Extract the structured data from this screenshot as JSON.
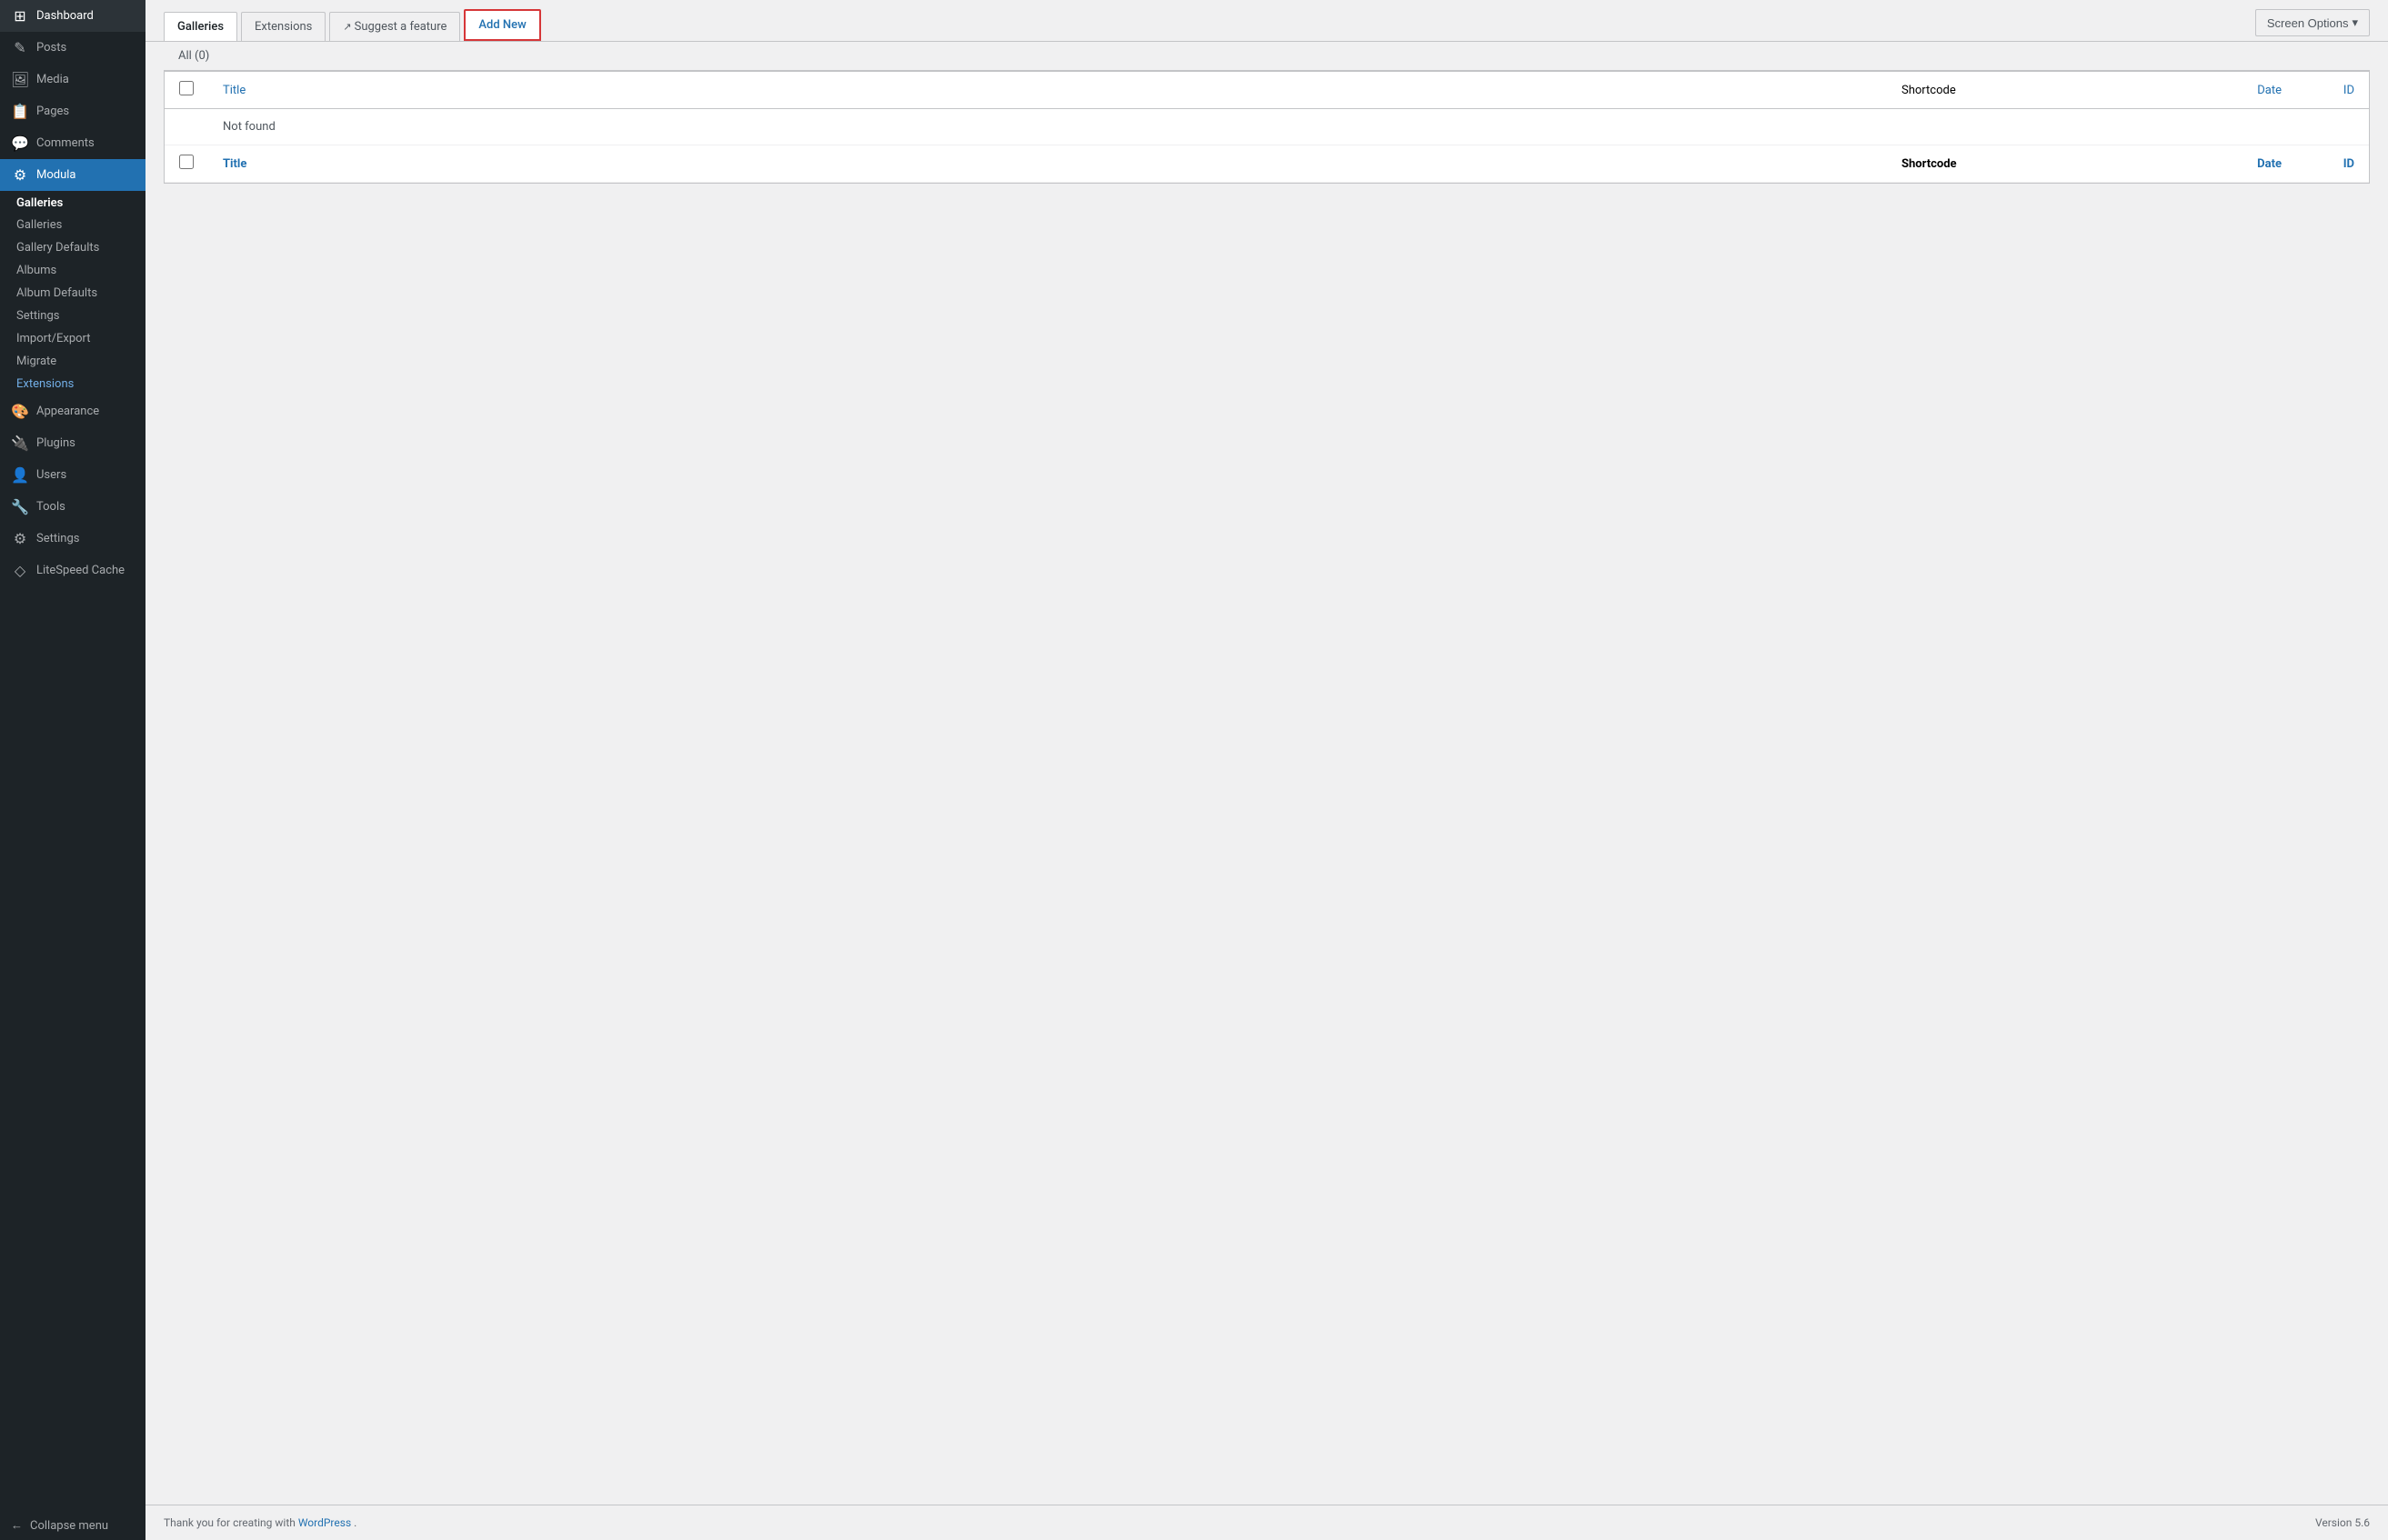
{
  "sidebar": {
    "items": [
      {
        "id": "dashboard",
        "label": "Dashboard",
        "icon": "⊞"
      },
      {
        "id": "posts",
        "label": "Posts",
        "icon": "📄"
      },
      {
        "id": "media",
        "label": "Media",
        "icon": "🖼"
      },
      {
        "id": "pages",
        "label": "Pages",
        "icon": "📋"
      },
      {
        "id": "comments",
        "label": "Comments",
        "icon": "💬"
      },
      {
        "id": "modula",
        "label": "Modula",
        "icon": "⚙"
      },
      {
        "id": "appearance",
        "label": "Appearance",
        "icon": "🎨"
      },
      {
        "id": "plugins",
        "label": "Plugins",
        "icon": "🔌"
      },
      {
        "id": "users",
        "label": "Users",
        "icon": "👤"
      },
      {
        "id": "tools",
        "label": "Tools",
        "icon": "🔧"
      },
      {
        "id": "settings",
        "label": "Settings",
        "icon": "⚙"
      },
      {
        "id": "litespeed",
        "label": "LiteSpeed Cache",
        "icon": "◇"
      }
    ],
    "modula_submenu": {
      "section_title": "Galleries",
      "items": [
        {
          "id": "galleries",
          "label": "Galleries",
          "active": false
        },
        {
          "id": "gallery-defaults",
          "label": "Gallery Defaults",
          "active": false
        },
        {
          "id": "albums",
          "label": "Albums",
          "active": false
        },
        {
          "id": "album-defaults",
          "label": "Album Defaults",
          "active": false
        },
        {
          "id": "settings",
          "label": "Settings",
          "active": false
        },
        {
          "id": "import-export",
          "label": "Import/Export",
          "active": false
        },
        {
          "id": "migrate",
          "label": "Migrate",
          "active": false
        },
        {
          "id": "extensions",
          "label": "Extensions",
          "active": true
        }
      ]
    },
    "collapse_label": "Collapse menu"
  },
  "header": {
    "tabs": [
      {
        "id": "galleries",
        "label": "Galleries",
        "active": true,
        "external": false,
        "highlighted": false
      },
      {
        "id": "extensions",
        "label": "Extensions",
        "active": false,
        "external": false,
        "highlighted": false
      },
      {
        "id": "suggest",
        "label": "Suggest a feature",
        "active": false,
        "external": true,
        "highlighted": false
      },
      {
        "id": "add-new",
        "label": "Add New",
        "active": false,
        "external": false,
        "highlighted": true
      }
    ],
    "screen_options_label": "Screen Options"
  },
  "content": {
    "filter_label": "All",
    "filter_count": "(0)",
    "table": {
      "headers": [
        {
          "id": "title",
          "label": "Title",
          "link": true
        },
        {
          "id": "shortcode",
          "label": "Shortcode",
          "link": false
        },
        {
          "id": "date",
          "label": "Date",
          "link": true
        },
        {
          "id": "id",
          "label": "ID",
          "link": true
        }
      ],
      "not_found_text": "Not found",
      "rows": []
    }
  },
  "footer": {
    "thank_you_text": "Thank you for creating with ",
    "wordpress_label": "WordPress",
    "version_label": "Version 5.6"
  }
}
